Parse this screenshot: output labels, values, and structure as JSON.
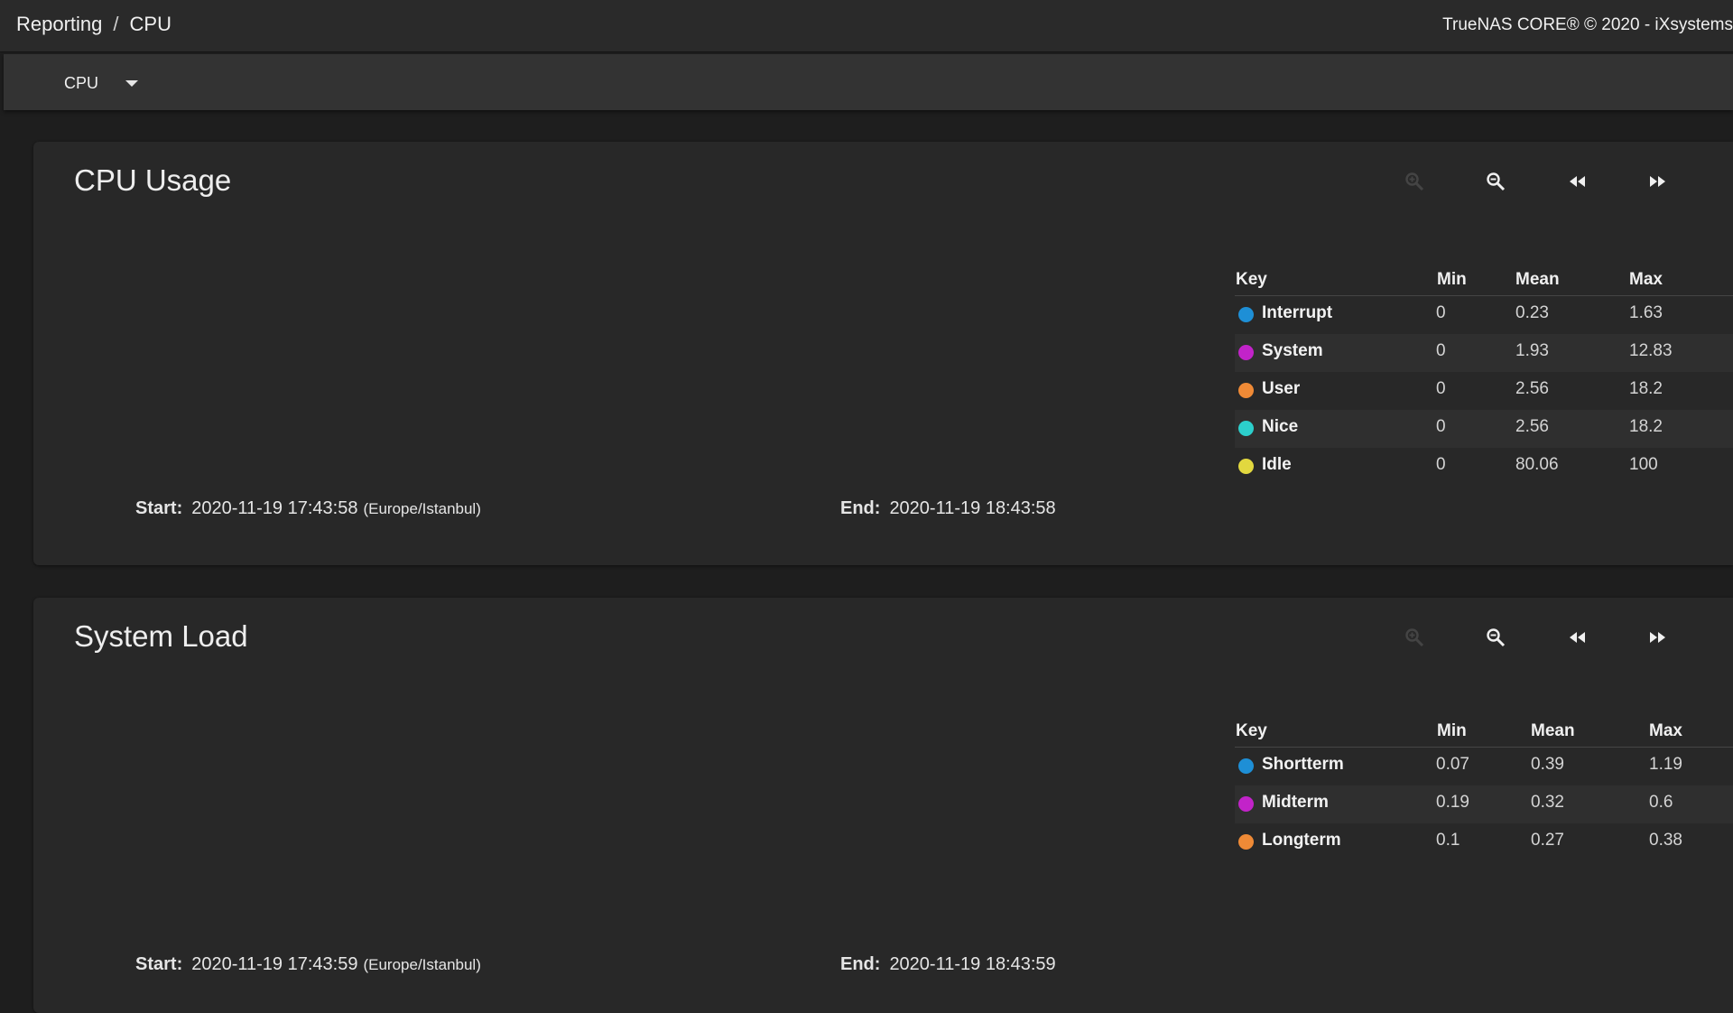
{
  "header": {
    "breadcrumb": [
      "Reporting",
      "CPU"
    ],
    "breadcrumb_separator": "/",
    "copyright": "TrueNAS CORE® © 2020 - iXsystems"
  },
  "selector": {
    "value": "CPU",
    "icon": "chevron-down-icon"
  },
  "toolbar_icons": [
    "zoom-in-icon",
    "zoom-out-icon",
    "step-back-icon",
    "step-forward-icon"
  ],
  "legend_headers": {
    "key": "Key",
    "min": "Min",
    "mean": "Mean",
    "max": "Max"
  },
  "cards": [
    {
      "title": "CPU Usage",
      "series": [
        {
          "name": "Interrupt",
          "color": "#1e8fd6",
          "min": "0",
          "mean": "0.23",
          "max": "1.63"
        },
        {
          "name": "System",
          "color": "#c223c9",
          "min": "0",
          "mean": "1.93",
          "max": "12.83"
        },
        {
          "name": "User",
          "color": "#ef8a36",
          "min": "0",
          "mean": "2.56",
          "max": "18.2"
        },
        {
          "name": "Nice",
          "color": "#2ccfcc",
          "min": "0",
          "mean": "2.56",
          "max": "18.2"
        },
        {
          "name": "Idle",
          "color": "#e2d83f",
          "min": "0",
          "mean": "80.06",
          "max": "100"
        }
      ],
      "start_label": "Start:",
      "start": "2020-11-19 17:43:58",
      "timezone": "(Europe/Istanbul)",
      "end_label": "End:",
      "end": "2020-11-19 18:43:58"
    },
    {
      "title": "System Load",
      "series": [
        {
          "name": "Shortterm",
          "color": "#1e8fd6",
          "min": "0.07",
          "mean": "0.39",
          "max": "1.19"
        },
        {
          "name": "Midterm",
          "color": "#c223c9",
          "min": "0.19",
          "mean": "0.32",
          "max": "0.6"
        },
        {
          "name": "Longterm",
          "color": "#ef8a36",
          "min": "0.1",
          "mean": "0.27",
          "max": "0.38"
        }
      ],
      "start_label": "Start:",
      "start": "2020-11-19 17:43:59",
      "timezone": "(Europe/Istanbul)",
      "end_label": "End:",
      "end": "2020-11-19 18:43:59"
    }
  ]
}
